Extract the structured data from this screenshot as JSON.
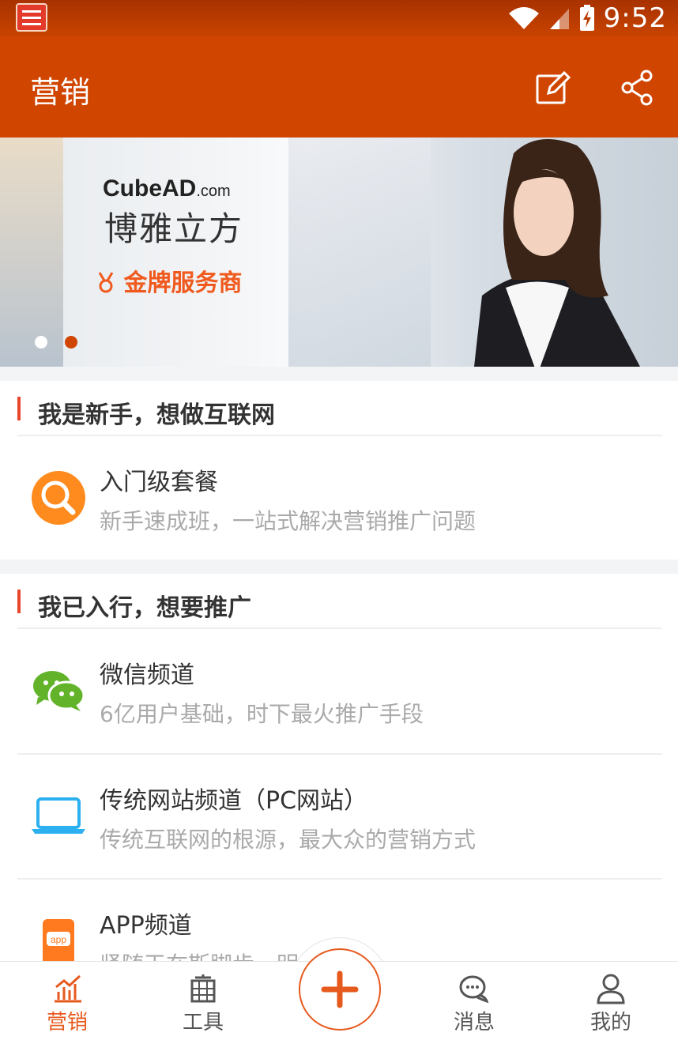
{
  "status": {
    "time": "9:52"
  },
  "appbar": {
    "title": "营销"
  },
  "banner": {
    "brand_en": "CubeAD",
    "brand_domain": ".com",
    "brand_cn": "博雅立方",
    "badge": "金牌服务商",
    "active_dot": 2,
    "dot_count": 2
  },
  "sections": [
    {
      "title": "我是新手，想做互联网",
      "items": [
        {
          "icon": "search-icon",
          "title": "入门级套餐",
          "subtitle": "新手速成班，一站式解决营销推广问题"
        }
      ]
    },
    {
      "title": "我已入行，想要推广",
      "items": [
        {
          "icon": "wechat-icon",
          "title": "微信频道",
          "subtitle": "6亿用户基础，时下最火推广手段"
        },
        {
          "icon": "laptop-icon",
          "title": "传统网站频道（PC网站）",
          "subtitle": "传统互联网的根源，最大众的营销方式"
        },
        {
          "icon": "app-icon",
          "title": "APP频道",
          "subtitle": "紧随天在斯脚步，明 潮流"
        }
      ]
    }
  ],
  "tabbar": {
    "tabs": [
      {
        "label": "营销",
        "icon": "chart-icon",
        "active": true
      },
      {
        "label": "工具",
        "icon": "toolbox-icon",
        "active": false
      },
      {
        "label": "消息",
        "icon": "chat-icon",
        "active": false
      },
      {
        "label": "我的",
        "icon": "user-icon",
        "active": false
      }
    ],
    "center_icon": "plus-icon"
  },
  "colors": {
    "primary": "#d04500",
    "accent": "#e65a1e",
    "section_bar": "#e8452b"
  }
}
